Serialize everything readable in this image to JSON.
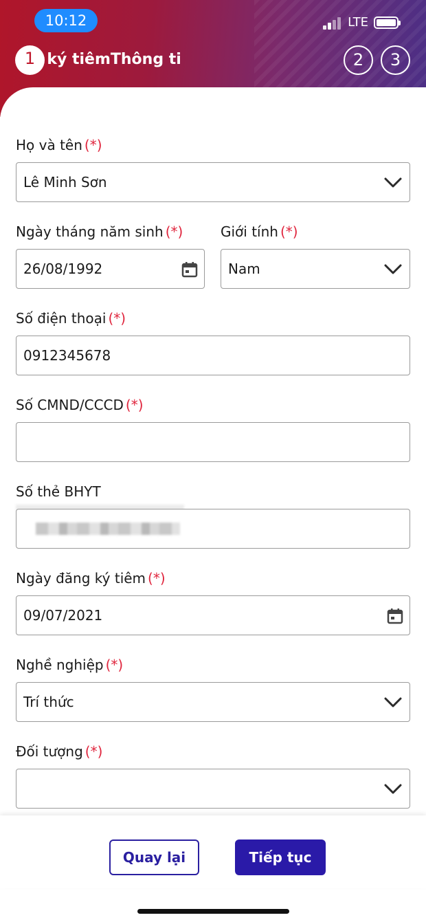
{
  "status_bar": {
    "time": "10:12",
    "network": "LTE",
    "icons": [
      "signal-icon",
      "battery-icon"
    ]
  },
  "stepper": {
    "steps": [
      "1",
      "2",
      "3"
    ],
    "active_index": 0,
    "title_visible": "Đăng ký tiêmThông ti"
  },
  "form": {
    "required_mark": "(*)",
    "full_name": {
      "label": "Họ và tên",
      "value": "Lê Minh Sơn"
    },
    "dob": {
      "label": "Ngày tháng năm sinh",
      "value": "26/08/1992"
    },
    "gender": {
      "label": "Giới tính",
      "value": "Nam"
    },
    "phone": {
      "label": "Số điện thoại",
      "value": "0912345678"
    },
    "id_card": {
      "label": "Số CMND/CCCD",
      "value": ""
    },
    "insurance": {
      "label": "Số thẻ BHYT"
    },
    "reg_date": {
      "label": "Ngày đăng ký tiêm",
      "value": "09/07/2021"
    },
    "occupation": {
      "label": "Nghề nghiệp",
      "value": "Trí thức"
    },
    "target_group": {
      "label": "Đối tượng",
      "value": ""
    }
  },
  "actions": {
    "back_label": "Quay lại",
    "next_label": "Tiếp tục"
  },
  "colors": {
    "primary": "#2a1aa8",
    "required": "#e0263e",
    "header_start": "#b0162a",
    "header_end": "#4b2f86"
  }
}
